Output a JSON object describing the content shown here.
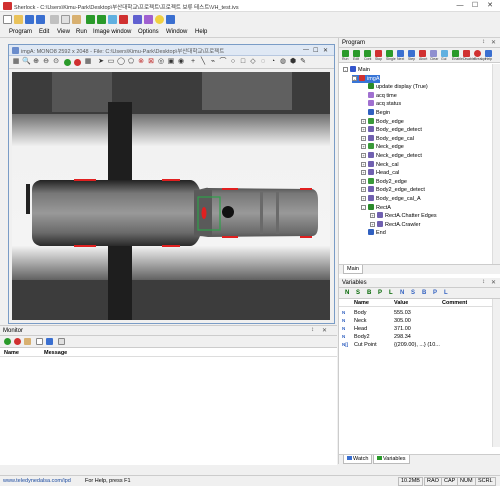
{
  "window": {
    "title": "Sherlock - C:\\Users\\Kimu-Park\\Desktop\\부산대학교\\프로젝트\\프로젝트 보류 테스트\\VH_test.ivs",
    "min": "—",
    "max": "☐",
    "close": "✕"
  },
  "menu": [
    "Program",
    "Edit",
    "View",
    "Run",
    "Image window",
    "Options",
    "Window",
    "Help"
  ],
  "image_window": {
    "title": "imgA: MONO8 2592 x 2048 - File: C:\\Users\\Kimu-Park\\Desktop\\부산대학교\\프로젝트",
    "min": "—",
    "max": "☐",
    "close": "✕"
  },
  "program": {
    "title": "Program",
    "pin": "↕",
    "close": "✕",
    "tool_labels": [
      "Run",
      "Edit",
      "Cont",
      "Stop",
      "Single",
      "Next",
      "Step",
      "Abort",
      "Clear",
      "Gui",
      "Enable",
      "Disable",
      "Breakpt",
      "Help"
    ],
    "tree": [
      {
        "label": "Main",
        "level": 0,
        "expander": "-",
        "color": "#3355cc"
      },
      {
        "label": "imgA",
        "level": 1,
        "expander": "-",
        "color": "#d03030",
        "selected": true
      },
      {
        "label": "update display (True)",
        "level": 2,
        "expander": "",
        "color": "#2a8a2a"
      },
      {
        "label": "acq time",
        "level": 2,
        "expander": "",
        "color": "#a070d0"
      },
      {
        "label": "acq status",
        "level": 2,
        "expander": "",
        "color": "#a070d0"
      },
      {
        "label": "Begin",
        "level": 2,
        "expander": "",
        "color": "#3060c0"
      },
      {
        "label": "Body_edge",
        "level": 2,
        "expander": "+",
        "color": "#3a9a3a"
      },
      {
        "label": "Body_edge_detect",
        "level": 2,
        "expander": "+",
        "color": "#7060b0"
      },
      {
        "label": "Body_edge_cal",
        "level": 2,
        "expander": "+",
        "color": "#7060b0"
      },
      {
        "label": "Neck_edge",
        "level": 2,
        "expander": "+",
        "color": "#3a9a3a"
      },
      {
        "label": "Neck_edge_detect",
        "level": 2,
        "expander": "+",
        "color": "#7060b0"
      },
      {
        "label": "Neck_cal",
        "level": 2,
        "expander": "+",
        "color": "#7060b0"
      },
      {
        "label": "Head_cal",
        "level": 2,
        "expander": "+",
        "color": "#7060b0"
      },
      {
        "label": "Body2_edge",
        "level": 2,
        "expander": "+",
        "color": "#3a9a3a"
      },
      {
        "label": "Body2_edge_detect",
        "level": 2,
        "expander": "+",
        "color": "#7060b0"
      },
      {
        "label": "Body_edge_cal_A",
        "level": 2,
        "expander": "+",
        "color": "#7060b0"
      },
      {
        "label": "RectA",
        "level": 2,
        "expander": "-",
        "color": "#2a8a2a"
      },
      {
        "label": "RectA.Chatter Edges",
        "level": 3,
        "expander": "+",
        "color": "#7060b0"
      },
      {
        "label": "RectA.Crawler",
        "level": 3,
        "expander": "+",
        "color": "#7060b0"
      },
      {
        "label": "End",
        "level": 2,
        "expander": "",
        "color": "#3060c0"
      }
    ],
    "tab": "Main"
  },
  "variables": {
    "title": "Variables",
    "pin": "↕",
    "close": "✕",
    "toolbar_letters": [
      "N",
      "S",
      "B",
      "P",
      "L",
      "N",
      "S",
      "B",
      "P",
      "L"
    ],
    "columns": [
      "Name",
      "Value",
      "Comment"
    ],
    "rows": [
      {
        "type": "N",
        "name": "Body",
        "value": "555.03",
        "comment": ""
      },
      {
        "type": "N",
        "name": "Neck",
        "value": "305.00",
        "comment": ""
      },
      {
        "type": "N",
        "name": "Head",
        "value": "371.00",
        "comment": ""
      },
      {
        "type": "N",
        "name": "Body2",
        "value": "298.34",
        "comment": ""
      },
      {
        "type": "N[]",
        "name": "Cut Point",
        "value": "{(209.00), ...} (10...",
        "comment": ""
      }
    ],
    "tabs": [
      "Watch",
      "Variables"
    ]
  },
  "monitor": {
    "title": "Monitor",
    "pin": "↕",
    "close": "✕",
    "columns": [
      "Name",
      "Message"
    ]
  },
  "status": {
    "link": "www.teledynedalsa.com/ipd",
    "help": "For Help, press F1",
    "mem": "10.2MB",
    "indicators": [
      "RAO",
      "CAP",
      "NUM",
      "SCRL"
    ]
  },
  "colors": {
    "accent": "#3060c0",
    "selection": "#3875d7",
    "edge_marker": "#e02020",
    "rect_roi": "#2ea04a"
  }
}
